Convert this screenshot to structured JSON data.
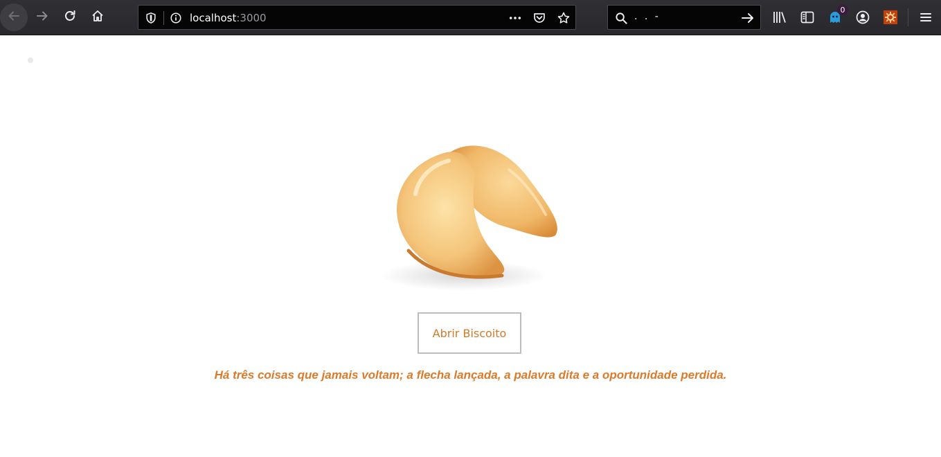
{
  "browser": {
    "url_host": "localhost",
    "url_port": ":3000",
    "search_value": "  . . -",
    "notification_count": "0",
    "colors": {
      "toolbar": "#2b2a33",
      "urlbar": "#050505"
    }
  },
  "icons": {
    "back": "back-arrow-icon",
    "forward": "forward-arrow-icon",
    "reload": "reload-icon",
    "home": "home-icon",
    "shield": "shield-icon",
    "info": "info-icon",
    "page_actions": "ellipsis-icon",
    "pocket": "pocket-icon",
    "bookmark": "star-icon",
    "search": "search-icon",
    "go": "go-arrow-icon",
    "library": "library-icon",
    "sidebar": "sidebar-icon",
    "ghost_extension": "ghost-icon",
    "account": "account-icon",
    "extension": "gear-extension-icon",
    "menu": "hamburger-menu-icon"
  },
  "page": {
    "image": "fortune-cookie",
    "button_label": "Abrir Biscoito",
    "fortune_text": "Há três coisas que jamais voltam; a flecha lançada, a palavra dita e a oportunidade perdida.",
    "colors": {
      "accent": "#dc7a2a",
      "button_border": "#bdbdbd"
    }
  }
}
